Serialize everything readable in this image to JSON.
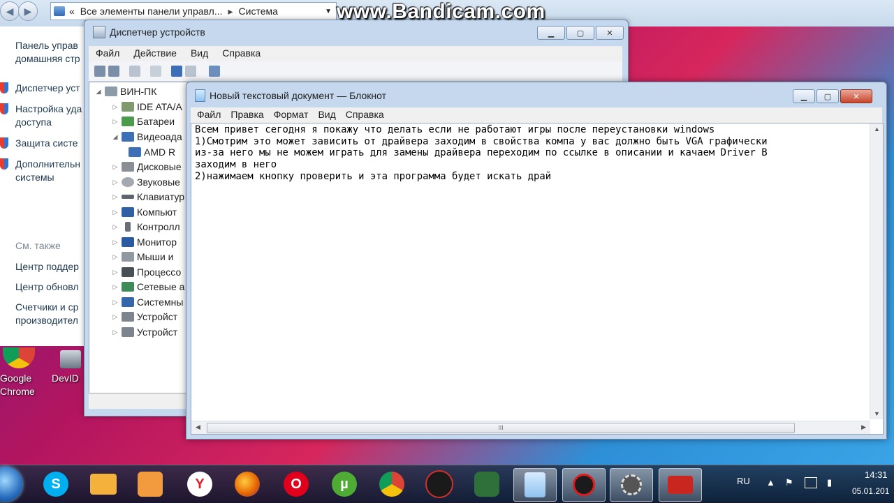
{
  "watermark": "www.Bandicam.com",
  "control_panel": {
    "address_breadcrumb": "Все элементы панели управл...",
    "address_current": "Система",
    "links": [
      "Панель управ",
      "домашняя стр",
      "Диспетчер уст",
      "Настройка уда",
      "доступа",
      "Защита систе",
      "Дополнительн",
      "системы"
    ],
    "see_also": "См. также",
    "see_also_links": [
      "Центр поддер",
      "Центр обновл",
      "Счетчики и ср",
      "производител"
    ]
  },
  "device_manager": {
    "title": "Диспетчер устройств",
    "menu": [
      "Файл",
      "Действие",
      "Вид",
      "Справка"
    ],
    "tree_root": "ВИН-ПК",
    "tree_items": [
      "IDE ATA/A",
      "Батареи",
      "Видеоада",
      "AMD R",
      "Дисковые",
      "Звуковые",
      "Клавиатур",
      "Компьют",
      "Контролл",
      "Монитор",
      "Мыши и",
      "Процессо",
      "Сетевые а",
      "Системны",
      "Устройст",
      "Устройст"
    ]
  },
  "notepad": {
    "title": "Новый текстовый документ — Блокнот",
    "menu": [
      "Файл",
      "Правка",
      "Формат",
      "Вид",
      "Справка"
    ],
    "text": "Всем привет сегодня я покажу что делать если не работают игры после переустановки windows\n1)Смотрим это может зависить от драйвера заходим в свойства компа у вас должно быть VGA графически\nиз-за него мы не можем играть для замены драйвера переходим по ссылке в описании и качаем Driver B\nзаходим в него\n2)нажимаем кнопку проверить и эта программа будет искать драй",
    "scroll_thumb": "III"
  },
  "desktop_icons": [
    "Google Chrome",
    "DevID"
  ],
  "taskbar": {
    "apps": [
      "skype-icon",
      "folder-icon",
      "media-player-icon",
      "yandex-browser-icon",
      "firefox-icon",
      "opera-icon",
      "utorrent-icon",
      "chrome-icon",
      "uc-app-icon",
      "snake-app-icon",
      "notepad-icon",
      "bandicam-record-icon",
      "settings-gear-icon",
      "toolbox-icon"
    ],
    "yandex_glyph": "Y",
    "skype_glyph": "S",
    "utorrent_glyph": "µ",
    "opera_glyph": "O",
    "language": "RU",
    "time": "14:31",
    "date": "05.01.201"
  }
}
